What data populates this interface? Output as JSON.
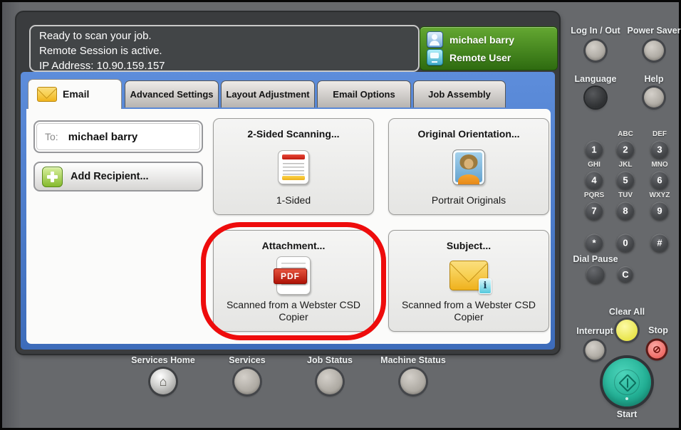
{
  "colors": {
    "panel_blue": "#4a7ac9",
    "badge_green": "#3f8c1a",
    "highlight_red": "#ee0c0c",
    "start_teal": "#2bbaa0"
  },
  "status": {
    "line1": "Ready to scan your job.",
    "line2": "Remote Session is active.",
    "line3": "IP Address: 10.90.159.157"
  },
  "user": {
    "name": "michael barry",
    "role": "Remote User"
  },
  "tabs": [
    {
      "label": "Email"
    },
    {
      "label": "Advanced Settings"
    },
    {
      "label": "Layout Adjustment"
    },
    {
      "label": "Email Options"
    },
    {
      "label": "Job Assembly"
    }
  ],
  "email_form": {
    "to_label": "To:",
    "to_value": "michael barry",
    "add_recipient": "Add Recipient..."
  },
  "tiles": [
    {
      "title": "2-Sided Scanning...",
      "value": "1-Sided"
    },
    {
      "title": "Original Orientation...",
      "value": "Portrait Originals"
    },
    {
      "title": "Attachment...",
      "value": "Scanned from a Webster CSD Copier"
    },
    {
      "title": "Subject...",
      "value": "Scanned from a Webster CSD Copier"
    }
  ],
  "glyphs": {
    "pdf_label": "PDF",
    "info": "i",
    "home": "⌂",
    "stop": "⊘"
  },
  "bottom_nav": {
    "services_home": "Services Home",
    "services": "Services",
    "job_status": "Job Status",
    "machine_status": "Machine Status"
  },
  "hard_keys": {
    "log_in_out": "Log In / Out",
    "power_saver": "Power Saver",
    "language": "Language",
    "help": "Help",
    "dial_pause": "Dial Pause",
    "clear": "C",
    "clear_all": "Clear All",
    "interrupt": "Interrupt",
    "stop": "Stop",
    "start": "Start",
    "keypad": [
      {
        "digit": "1",
        "letters": ""
      },
      {
        "digit": "2",
        "letters": "ABC"
      },
      {
        "digit": "3",
        "letters": "DEF"
      },
      {
        "digit": "4",
        "letters": "GHI"
      },
      {
        "digit": "5",
        "letters": "JKL"
      },
      {
        "digit": "6",
        "letters": "MNO"
      },
      {
        "digit": "7",
        "letters": "PQRS"
      },
      {
        "digit": "8",
        "letters": "TUV"
      },
      {
        "digit": "9",
        "letters": "WXYZ"
      },
      {
        "digit": "*",
        "letters": ""
      },
      {
        "digit": "0",
        "letters": ""
      },
      {
        "digit": "#",
        "letters": ""
      }
    ]
  }
}
